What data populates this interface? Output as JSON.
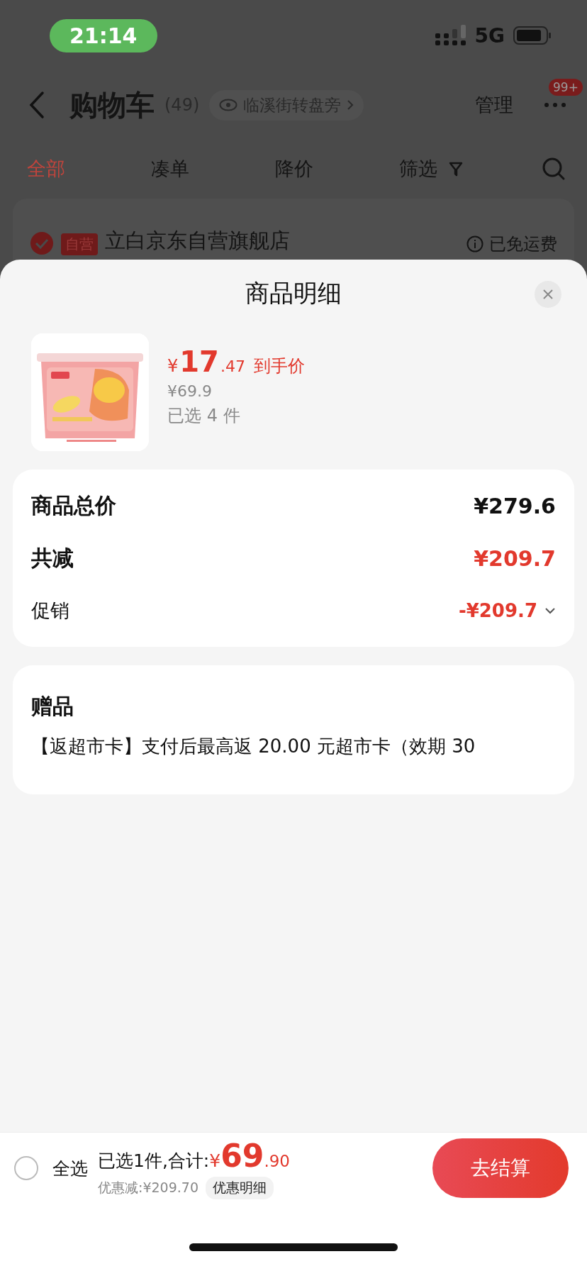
{
  "status_bar": {
    "time": "21:14",
    "network": "5G"
  },
  "nav": {
    "title": "购物车",
    "count": "(49)",
    "location": "临溪街转盘旁",
    "manage": "管理",
    "badge": "99+"
  },
  "tabs": [
    {
      "label": "全部",
      "selected": true,
      "kind": "plain"
    },
    {
      "label": "凑单",
      "selected": false,
      "kind": "plain"
    },
    {
      "label": "降价",
      "selected": false,
      "kind": "plain"
    },
    {
      "label": "筛选",
      "selected": false,
      "kind": "filter"
    }
  ],
  "store": {
    "checked": true,
    "tag": "自营",
    "name": "立白京东自营旗舰店",
    "shipping": "已免运费"
  },
  "sheet": {
    "title": "商品明细",
    "product": {
      "currency": "¥",
      "price_int": "17",
      "price_dec": ".47",
      "price_label": "到手价",
      "original_price": "¥69.9",
      "quantity": "已选 4 件"
    },
    "summary": [
      {
        "label": "商品总价",
        "value": "¥279.6",
        "kind": "total"
      },
      {
        "label": "共减",
        "value": "¥209.7",
        "kind": "reduction"
      },
      {
        "label": "促销",
        "value": "-¥209.7",
        "kind": "promo"
      }
    ],
    "gift": {
      "title": "赠品",
      "text": "【返超市卡】支付后最高返 20.00 元超市卡（效期 30"
    }
  },
  "bottom_bar": {
    "select_all": {
      "label": "全选",
      "checked": false
    },
    "total_label": "已选1件,合计:",
    "currency": "¥",
    "total_int": "69",
    "total_dec": ".90",
    "discount": "优惠减:¥209.70",
    "detail_button": "优惠明细",
    "checkout": "去结算"
  }
}
